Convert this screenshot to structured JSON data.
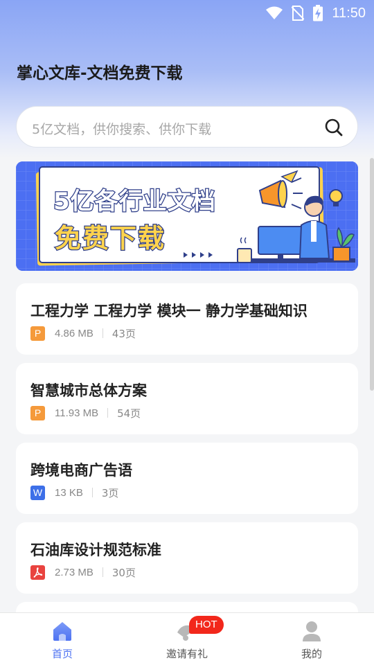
{
  "status_bar": {
    "time": "11:50",
    "icons": [
      "wifi-icon",
      "no-sim-icon",
      "battery-charging-icon"
    ]
  },
  "header": {
    "title": "掌心文库-文档免费下载"
  },
  "search": {
    "placeholder": "5亿文档，供你搜索、供你下载",
    "icon": "search-icon"
  },
  "banner": {
    "line1": "5亿各行业文档",
    "line2": "免费下载"
  },
  "documents": [
    {
      "title": "工程力学 工程力学 模块一  静力学基础知识",
      "type": "P",
      "type_kind": "ppt",
      "size": "4.86 MB",
      "pages": "43页"
    },
    {
      "title": "智慧城市总体方案",
      "type": "P",
      "type_kind": "ppt",
      "size": "11.93 MB",
      "pages": "54页"
    },
    {
      "title": "跨境电商广告语",
      "type": "W",
      "type_kind": "word",
      "size": "13 KB",
      "pages": "3页"
    },
    {
      "title": "石油库设计规范标准",
      "type": "",
      "type_kind": "pdf",
      "size": "2.73 MB",
      "pages": "30页"
    }
  ],
  "tabbar": {
    "tabs": [
      {
        "label": "首页",
        "icon": "home-icon",
        "active": true
      },
      {
        "label": "邀请有礼",
        "icon": "gift-icon",
        "badge": "HOT"
      },
      {
        "label": "我的",
        "icon": "user-icon"
      }
    ]
  },
  "colors": {
    "accent": "#4d72f2",
    "hot": "#f2271b",
    "ppt": "#f59a3b",
    "word": "#3d6fe8",
    "pdf": "#e9433f"
  }
}
